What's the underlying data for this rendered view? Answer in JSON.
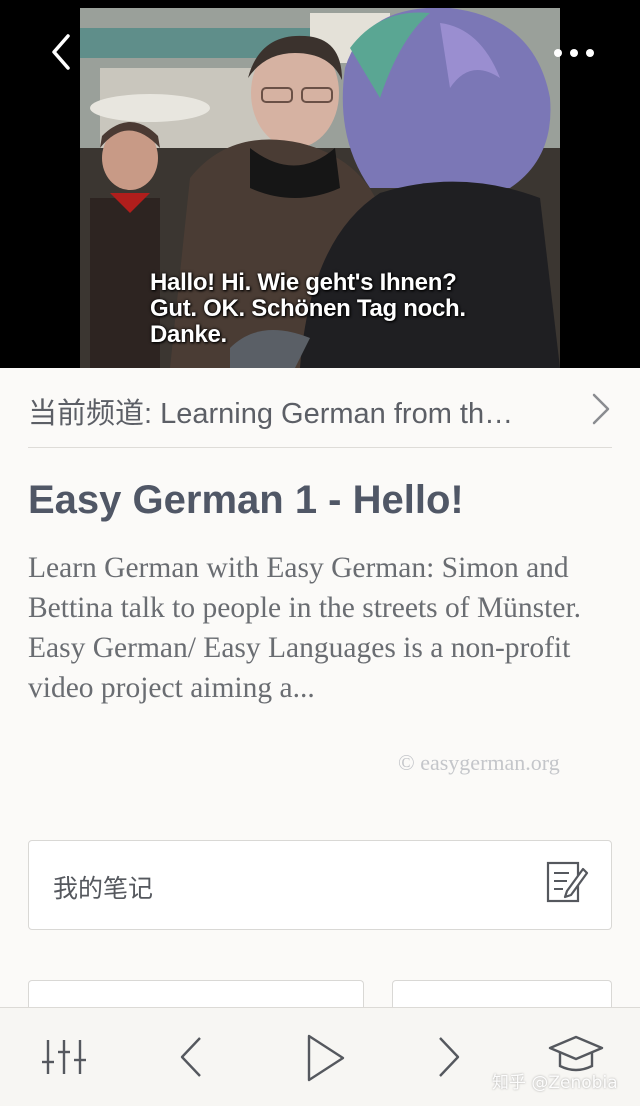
{
  "video": {
    "subtitle": "Hallo! Hi. Wie geht's Ihnen?\nGut. OK. Schönen Tag noch.\nDanke."
  },
  "channel": {
    "text": "当前频道: Learning German from th…"
  },
  "episode": {
    "title": "Easy German 1 - Hello!",
    "description": "Learn German with Easy German: Simon and Bettina talk to people in the streets of Münster. Easy German/ Easy Languages is a non-profit video project aiming a...",
    "source": "© easygerman.org"
  },
  "notes": {
    "label": "我的笔记"
  },
  "watermark": "知乎 @Zenobia",
  "icons": {
    "back": "chevron-left-icon",
    "more": "more-dots-icon",
    "channel_next": "chevron-right-icon",
    "notes": "edit-note-icon",
    "settings": "equalizer-icon",
    "prev": "previous-icon",
    "play": "play-icon",
    "next": "next-icon",
    "learn": "graduation-cap-icon"
  }
}
